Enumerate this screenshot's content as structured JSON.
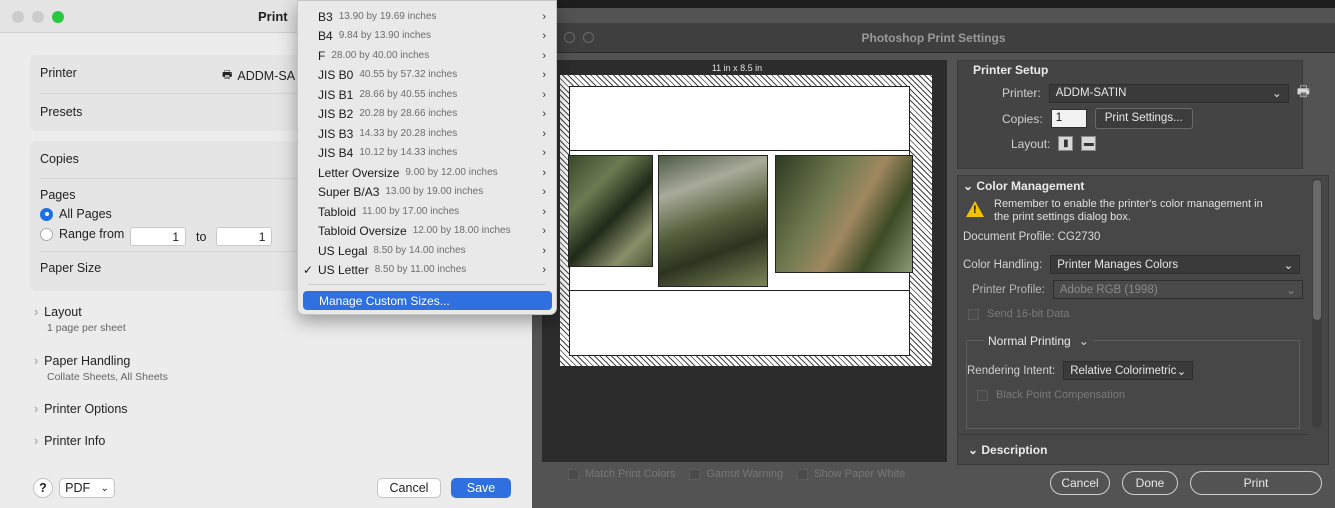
{
  "print_dialog": {
    "title": "Print",
    "printer_label": "Printer",
    "printer_value": "ADDM-SA",
    "presets_label": "Presets",
    "copies_label": "Copies",
    "pages_label": "Pages",
    "all_pages": "All Pages",
    "range_from": "Range from",
    "range_from_value": "1",
    "range_to": "to",
    "range_to_value": "1",
    "paper_size_label": "Paper Size",
    "sections": [
      {
        "title": "Layout",
        "subtitle": "1 page per sheet"
      },
      {
        "title": "Paper Handling",
        "subtitle": "Collate Sheets, All Sheets"
      },
      {
        "title": "Printer Options",
        "subtitle": ""
      },
      {
        "title": "Printer Info",
        "subtitle": ""
      }
    ],
    "help": "?",
    "pdf": "PDF",
    "cancel": "Cancel",
    "save": "Save"
  },
  "paper_menu": {
    "items": [
      {
        "name": "B3",
        "dims": "13.90 by 19.69 inches"
      },
      {
        "name": "B4",
        "dims": "9.84 by 13.90 inches"
      },
      {
        "name": "F",
        "dims": "28.00 by 40.00 inches"
      },
      {
        "name": "JIS B0",
        "dims": "40.55 by 57.32 inches"
      },
      {
        "name": "JIS B1",
        "dims": "28.66 by 40.55 inches"
      },
      {
        "name": "JIS B2",
        "dims": "20.28 by 28.66 inches"
      },
      {
        "name": "JIS B3",
        "dims": "14.33 by 20.28 inches"
      },
      {
        "name": "JIS B4",
        "dims": "10.12 by 14.33 inches"
      },
      {
        "name": "Letter Oversize",
        "dims": "9.00 by 12.00 inches"
      },
      {
        "name": "Super B/A3",
        "dims": "13.00 by 19.00 inches"
      },
      {
        "name": "Tabloid",
        "dims": "11.00 by 17.00 inches"
      },
      {
        "name": "Tabloid Oversize",
        "dims": "12.00 by 18.00 inches"
      },
      {
        "name": "US Legal",
        "dims": "8.50 by 14.00 inches"
      },
      {
        "name": "US Letter",
        "dims": "8.50 by 11.00 inches",
        "checked": true
      }
    ],
    "manage": "Manage Custom Sizes..."
  },
  "photoshop": {
    "title": "Photoshop Print Settings",
    "paper_label": "11 in x 8.5 in",
    "printer_setup": "Printer Setup",
    "printer_label": "Printer:",
    "printer_value": "ADDM-SATIN",
    "copies_label": "Copies:",
    "copies_value": "1",
    "print_settings": "Print Settings...",
    "layout_label": "Layout:",
    "color_management": "Color Management",
    "warning": "Remember to enable the printer's color management in the print settings dialog box.",
    "document_profile": "Document Profile: CG2730",
    "color_handling_label": "Color Handling:",
    "color_handling_value": "Printer Manages Colors",
    "printer_profile_label": "Printer Profile:",
    "printer_profile_value": "Adobe RGB (1998)",
    "send_16bit": "Send 16-bit Data",
    "normal_printing": "Normal Printing",
    "rendering_intent_label": "Rendering Intent:",
    "rendering_intent_value": "Relative Colorimetric",
    "black_point": "Black Point Compensation",
    "description": "Description",
    "match_print_colors": "Match Print Colors",
    "gamut_warning": "Gamut Warning",
    "show_paper_white": "Show Paper White",
    "cancel": "Cancel",
    "done": "Done",
    "print": "Print"
  },
  "colors": {
    "accent": "#2f6fe0",
    "warning": "#f3c300",
    "ps_bg": "#535353"
  }
}
